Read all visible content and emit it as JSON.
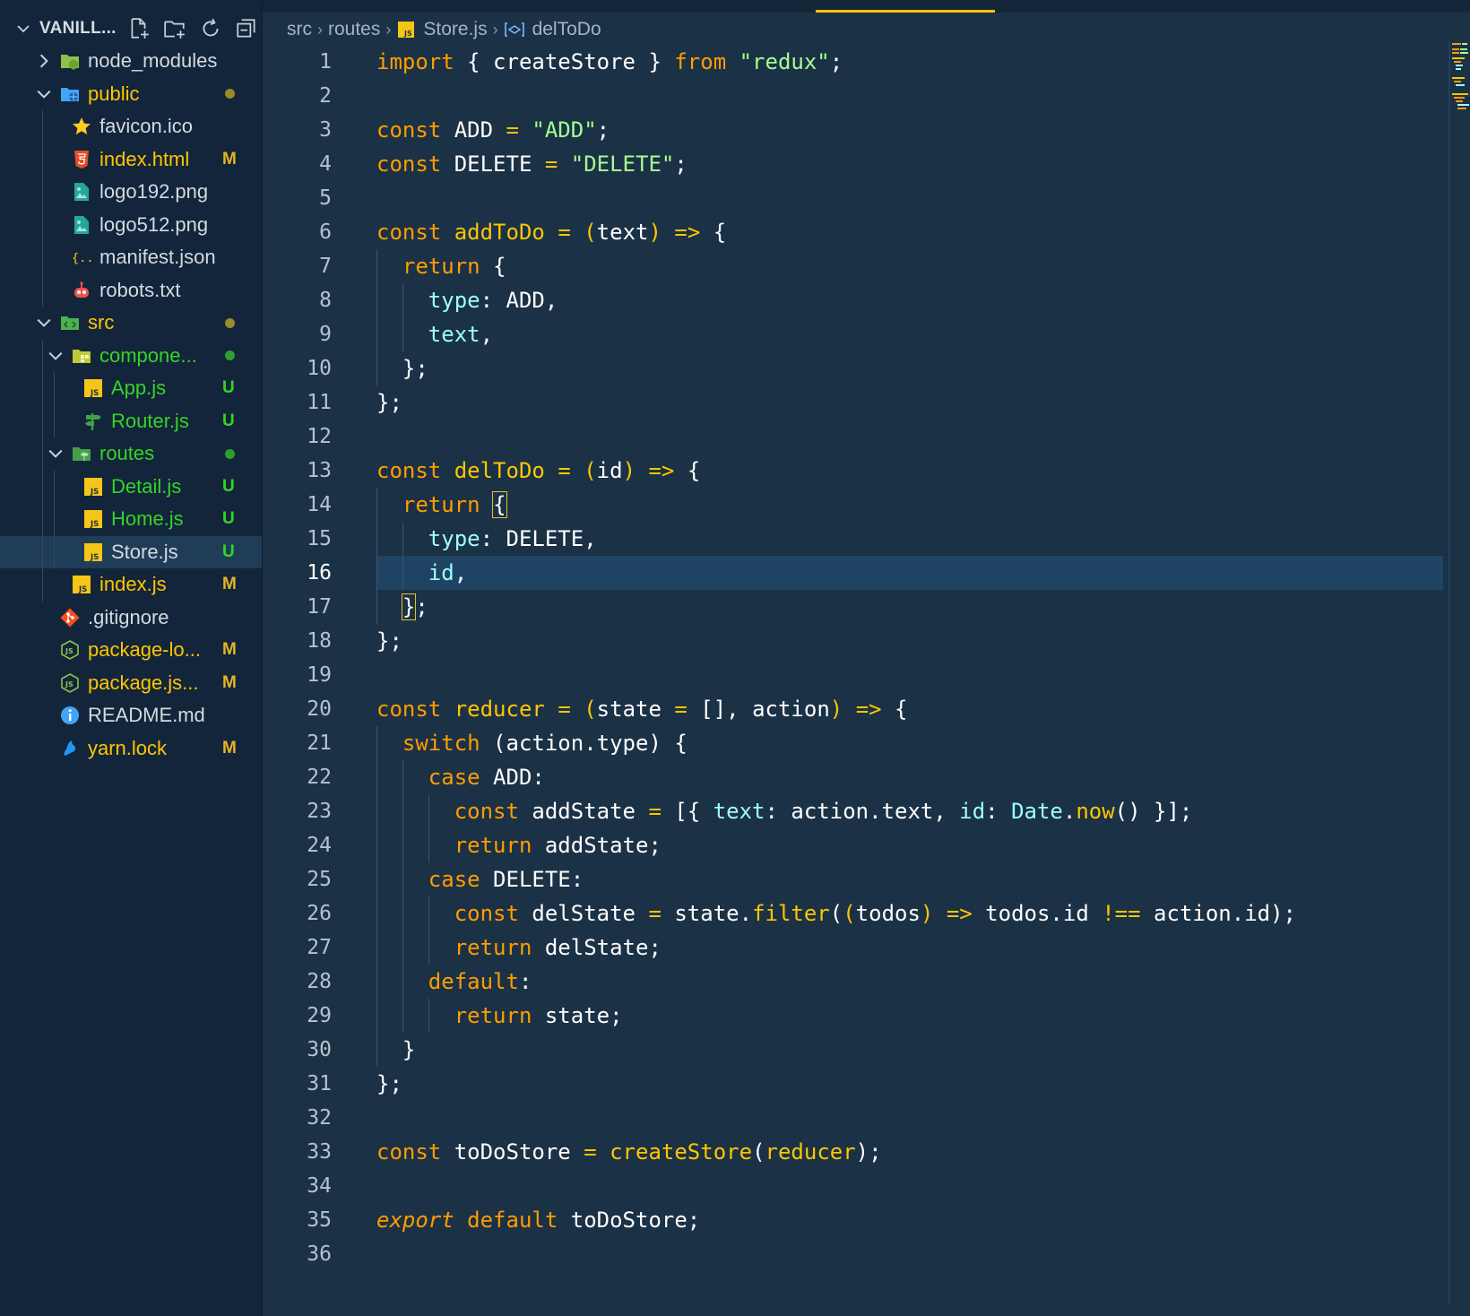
{
  "sidebar": {
    "title": "VANILL...",
    "actions": [
      {
        "name": "new-file-icon"
      },
      {
        "name": "new-folder-icon"
      },
      {
        "name": "refresh-icon"
      },
      {
        "name": "collapse-all-icon"
      }
    ],
    "items": [
      {
        "label": "node_modules",
        "type": "folder",
        "depth": 0,
        "expanded": false,
        "color": "white",
        "icon": "node-folder-icon"
      },
      {
        "label": "public",
        "type": "folder",
        "depth": 0,
        "expanded": true,
        "color": "yellow",
        "status": "dot-yellow",
        "icon": "public-folder-icon"
      },
      {
        "label": "favicon.ico",
        "type": "file",
        "depth": 1,
        "color": "white",
        "icon": "star-icon"
      },
      {
        "label": "index.html",
        "type": "file",
        "depth": 1,
        "color": "yellow",
        "badge": "M",
        "icon": "html5-icon"
      },
      {
        "label": "logo192.png",
        "type": "file",
        "depth": 1,
        "color": "white",
        "icon": "image-file-icon"
      },
      {
        "label": "logo512.png",
        "type": "file",
        "depth": 1,
        "color": "white",
        "icon": "image-file-icon"
      },
      {
        "label": "manifest.json",
        "type": "file",
        "depth": 1,
        "color": "white",
        "icon": "json-icon"
      },
      {
        "label": "robots.txt",
        "type": "file",
        "depth": 1,
        "color": "white",
        "icon": "robot-icon"
      },
      {
        "label": "src",
        "type": "folder",
        "depth": 0,
        "expanded": true,
        "color": "yellow",
        "status": "dot-yellow",
        "icon": "src-folder-icon"
      },
      {
        "label": "compone...",
        "type": "folder",
        "depth": 1,
        "expanded": true,
        "color": "green",
        "status": "dot-green",
        "icon": "components-folder-icon"
      },
      {
        "label": "App.js",
        "type": "file",
        "depth": 2,
        "color": "green",
        "badge": "U",
        "icon": "js-file-icon"
      },
      {
        "label": "Router.js",
        "type": "file",
        "depth": 2,
        "color": "green",
        "badge": "U",
        "icon": "signpost-icon"
      },
      {
        "label": "routes",
        "type": "folder",
        "depth": 1,
        "expanded": true,
        "color": "green",
        "status": "dot-green",
        "icon": "routes-folder-icon"
      },
      {
        "label": "Detail.js",
        "type": "file",
        "depth": 2,
        "color": "green",
        "badge": "U",
        "icon": "js-file-icon"
      },
      {
        "label": "Home.js",
        "type": "file",
        "depth": 2,
        "color": "green",
        "badge": "U",
        "icon": "js-file-icon"
      },
      {
        "label": "Store.js",
        "type": "file",
        "depth": 2,
        "color": "white",
        "badge": "U",
        "icon": "js-file-icon",
        "selected": true
      },
      {
        "label": "index.js",
        "type": "file",
        "depth": 1,
        "color": "yellow",
        "badge": "M",
        "icon": "js-file-icon"
      },
      {
        "label": ".gitignore",
        "type": "file",
        "depth": 0,
        "color": "white",
        "icon": "git-icon"
      },
      {
        "label": "package-lo...",
        "type": "file",
        "depth": 0,
        "color": "yellow",
        "badge": "M",
        "icon": "nodejs-icon"
      },
      {
        "label": "package.js...",
        "type": "file",
        "depth": 0,
        "color": "yellow",
        "badge": "M",
        "icon": "nodejs-icon"
      },
      {
        "label": "README.md",
        "type": "file",
        "depth": 0,
        "color": "white",
        "icon": "info-icon"
      },
      {
        "label": "yarn.lock",
        "type": "file",
        "depth": 0,
        "color": "yellow",
        "badge": "M",
        "icon": "yarn-icon"
      }
    ]
  },
  "breadcrumb": {
    "items": [
      "src",
      "routes",
      "Store.js",
      "delToDo"
    ]
  },
  "editor": {
    "active_line": 16,
    "lines": [
      [
        [
          "kw",
          "import"
        ],
        [
          "wh",
          " { createStore } "
        ],
        [
          "kw",
          "from"
        ],
        [
          "wh",
          " "
        ],
        [
          "st",
          "\"redux\""
        ],
        [
          "wh",
          ";"
        ]
      ],
      [],
      [
        [
          "kw",
          "const"
        ],
        [
          "wh",
          " ADD "
        ],
        [
          "ky",
          "="
        ],
        [
          "wh",
          " "
        ],
        [
          "st",
          "\"ADD\""
        ],
        [
          "wh",
          ";"
        ]
      ],
      [
        [
          "kw",
          "const"
        ],
        [
          "wh",
          " DELETE "
        ],
        [
          "ky",
          "="
        ],
        [
          "wh",
          " "
        ],
        [
          "st",
          "\"DELETE\""
        ],
        [
          "wh",
          ";"
        ]
      ],
      [],
      [
        [
          "kw",
          "const"
        ],
        [
          "wh",
          " "
        ],
        [
          "fn",
          "addToDo"
        ],
        [
          "wh",
          " "
        ],
        [
          "ky",
          "="
        ],
        [
          "wh",
          " "
        ],
        [
          "ky",
          "("
        ],
        [
          "wh",
          "text"
        ],
        [
          "ky",
          ")"
        ],
        [
          "wh",
          " "
        ],
        [
          "ky",
          "=>"
        ],
        [
          "wh",
          " {"
        ]
      ],
      [
        [
          "wh",
          "  "
        ],
        [
          "kw",
          "return"
        ],
        [
          "wh",
          " {"
        ]
      ],
      [
        [
          "wh",
          "    "
        ],
        [
          "pr",
          "type"
        ],
        [
          "wh",
          ": ADD,"
        ]
      ],
      [
        [
          "wh",
          "    "
        ],
        [
          "pr",
          "text"
        ],
        [
          "wh",
          ","
        ]
      ],
      [
        [
          "wh",
          "  };"
        ]
      ],
      [
        [
          "wh",
          "};"
        ]
      ],
      [],
      [
        [
          "kw",
          "const"
        ],
        [
          "wh",
          " "
        ],
        [
          "fn",
          "delToDo"
        ],
        [
          "wh",
          " "
        ],
        [
          "ky",
          "="
        ],
        [
          "wh",
          " "
        ],
        [
          "ky",
          "("
        ],
        [
          "wh",
          "id"
        ],
        [
          "ky",
          ")"
        ],
        [
          "wh",
          " "
        ],
        [
          "ky",
          "=>"
        ],
        [
          "wh",
          " {"
        ]
      ],
      [
        [
          "wh",
          "  "
        ],
        [
          "kw",
          "return"
        ],
        [
          "wh",
          " "
        ],
        [
          "bm",
          "{"
        ]
      ],
      [
        [
          "wh",
          "    "
        ],
        [
          "pr",
          "type"
        ],
        [
          "wh",
          ": DELETE,"
        ]
      ],
      [
        [
          "wh",
          "    "
        ],
        [
          "pr",
          "id"
        ],
        [
          "wh",
          ","
        ]
      ],
      [
        [
          "wh",
          "  "
        ],
        [
          "bm",
          "}"
        ],
        [
          "wh",
          ";"
        ]
      ],
      [
        [
          "wh",
          "};"
        ]
      ],
      [],
      [
        [
          "kw",
          "const"
        ],
        [
          "wh",
          " "
        ],
        [
          "fn",
          "reducer"
        ],
        [
          "wh",
          " "
        ],
        [
          "ky",
          "="
        ],
        [
          "wh",
          " "
        ],
        [
          "ky",
          "("
        ],
        [
          "wh",
          "state "
        ],
        [
          "ky",
          "="
        ],
        [
          "wh",
          " [], action"
        ],
        [
          "ky",
          ")"
        ],
        [
          "wh",
          " "
        ],
        [
          "ky",
          "=>"
        ],
        [
          "wh",
          " {"
        ]
      ],
      [
        [
          "wh",
          "  "
        ],
        [
          "kw",
          "switch"
        ],
        [
          "wh",
          " (action.type) {"
        ]
      ],
      [
        [
          "wh",
          "    "
        ],
        [
          "kw",
          "case"
        ],
        [
          "wh",
          " ADD:"
        ]
      ],
      [
        [
          "wh",
          "      "
        ],
        [
          "kw",
          "const"
        ],
        [
          "wh",
          " addState "
        ],
        [
          "ky",
          "="
        ],
        [
          "wh",
          " [{ "
        ],
        [
          "pr",
          "text"
        ],
        [
          "wh",
          ": action.text, "
        ],
        [
          "pr",
          "id"
        ],
        [
          "wh",
          ": "
        ],
        [
          "dk",
          "Date"
        ],
        [
          "wh",
          "."
        ],
        [
          "fn",
          "now"
        ],
        [
          "wh",
          "() }];"
        ]
      ],
      [
        [
          "wh",
          "      "
        ],
        [
          "kw",
          "return"
        ],
        [
          "wh",
          " addState;"
        ]
      ],
      [
        [
          "wh",
          "    "
        ],
        [
          "kw",
          "case"
        ],
        [
          "wh",
          " DELETE:"
        ]
      ],
      [
        [
          "wh",
          "      "
        ],
        [
          "kw",
          "const"
        ],
        [
          "wh",
          " delState "
        ],
        [
          "ky",
          "="
        ],
        [
          "wh",
          " state."
        ],
        [
          "fn",
          "filter"
        ],
        [
          "wh",
          "("
        ],
        [
          "ky",
          "("
        ],
        [
          "wh",
          "todos"
        ],
        [
          "ky",
          ")"
        ],
        [
          "wh",
          " "
        ],
        [
          "ky",
          "=>"
        ],
        [
          "wh",
          " todos.id "
        ],
        [
          "ky",
          "!=="
        ],
        [
          "wh",
          " action.id);"
        ]
      ],
      [
        [
          "wh",
          "      "
        ],
        [
          "kw",
          "return"
        ],
        [
          "wh",
          " delState;"
        ]
      ],
      [
        [
          "wh",
          "    "
        ],
        [
          "kw",
          "default"
        ],
        [
          "wh",
          ":"
        ]
      ],
      [
        [
          "wh",
          "      "
        ],
        [
          "kw",
          "return"
        ],
        [
          "wh",
          " state;"
        ]
      ],
      [
        [
          "wh",
          "  }"
        ]
      ],
      [
        [
          "wh",
          "};"
        ]
      ],
      [],
      [
        [
          "kw",
          "const"
        ],
        [
          "wh",
          " toDoStore "
        ],
        [
          "ky",
          "="
        ],
        [
          "wh",
          " "
        ],
        [
          "fn",
          "createStore"
        ],
        [
          "wh",
          "("
        ],
        [
          "ky",
          "reducer"
        ],
        [
          "wh",
          ");"
        ]
      ],
      [],
      [
        [
          "it",
          "export"
        ],
        [
          "wh",
          " "
        ],
        [
          "kw",
          "default"
        ],
        [
          "wh",
          " toDoStore;"
        ]
      ],
      []
    ]
  },
  "colors": {
    "accent": "#ffc600",
    "keyword": "#ff9d00",
    "string": "#a5ff90",
    "property": "#9effff",
    "untracked": "#35d427",
    "modified": "#e6b422"
  }
}
